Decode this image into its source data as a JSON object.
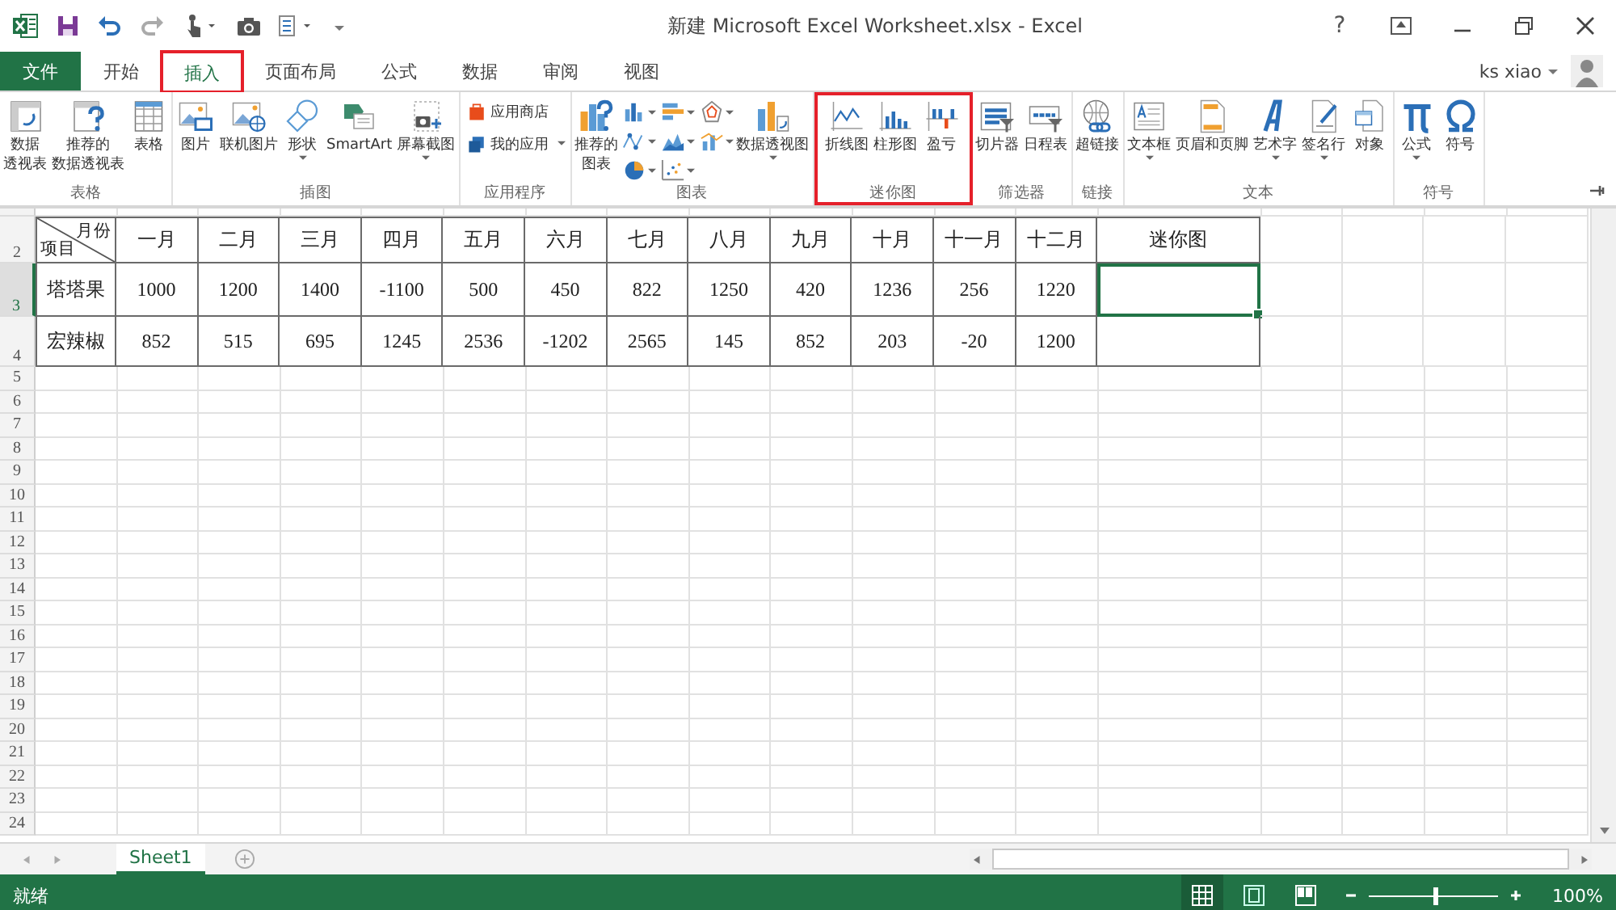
{
  "window": {
    "title": "新建 Microsoft Excel Worksheet.xlsx - Excel",
    "help": "?"
  },
  "tabs": [
    {
      "label": "文件",
      "kind": "file",
      "selected": false,
      "annotated": false
    },
    {
      "label": "开始",
      "kind": "tab",
      "selected": false,
      "annotated": false
    },
    {
      "label": "插入",
      "kind": "tab",
      "selected": true,
      "annotated": true
    },
    {
      "label": "页面布局",
      "kind": "tab",
      "selected": false,
      "annotated": false
    },
    {
      "label": "公式",
      "kind": "tab",
      "selected": false,
      "annotated": false
    },
    {
      "label": "数据",
      "kind": "tab",
      "selected": false,
      "annotated": false
    },
    {
      "label": "审阅",
      "kind": "tab",
      "selected": false,
      "annotated": false
    },
    {
      "label": "视图",
      "kind": "tab",
      "selected": false,
      "annotated": false
    }
  ],
  "user": {
    "name": "ks xiao"
  },
  "ribbon": [
    {
      "label": "表格",
      "annotated": false,
      "items": [
        {
          "kind": "large",
          "label": "数据透视表",
          "dropdown": false
        },
        {
          "kind": "large",
          "label": "推荐的数据透视表",
          "dropdown": false
        },
        {
          "kind": "large",
          "label": "表格",
          "dropdown": false
        }
      ]
    },
    {
      "label": "插图",
      "annotated": false,
      "items": [
        {
          "kind": "large",
          "label": "图片",
          "dropdown": false
        },
        {
          "kind": "large",
          "label": "联机图片",
          "dropdown": false
        },
        {
          "kind": "large",
          "label": "形状",
          "dropdown": true
        },
        {
          "kind": "large",
          "label": "SmartArt",
          "dropdown": false
        },
        {
          "kind": "large",
          "label": "屏幕截图",
          "dropdown": true
        }
      ]
    },
    {
      "label": "应用程序",
      "annotated": false,
      "items": [
        {
          "kind": "small",
          "label": "应用商店",
          "dropdown": false
        },
        {
          "kind": "small",
          "label": "我的应用",
          "dropdown": true
        }
      ]
    },
    {
      "label": "图表",
      "annotated": false,
      "items": [
        {
          "kind": "large",
          "label": "推荐的图表",
          "dropdown": false
        },
        {
          "kind": "gallery"
        },
        {
          "kind": "large",
          "label": "数据透视图",
          "dropdown": true
        }
      ]
    },
    {
      "label": "迷你图",
      "annotated": true,
      "items": [
        {
          "kind": "large",
          "label": "折线图",
          "dropdown": false
        },
        {
          "kind": "large",
          "label": "柱形图",
          "dropdown": false
        },
        {
          "kind": "large",
          "label": "盈亏",
          "dropdown": false
        }
      ]
    },
    {
      "label": "筛选器",
      "annotated": false,
      "items": [
        {
          "kind": "large",
          "label": "切片器",
          "dropdown": false
        },
        {
          "kind": "large",
          "label": "日程表",
          "dropdown": false
        }
      ]
    },
    {
      "label": "链接",
      "annotated": false,
      "items": [
        {
          "kind": "large",
          "label": "超链接",
          "dropdown": false
        }
      ]
    },
    {
      "label": "文本",
      "annotated": false,
      "items": [
        {
          "kind": "large",
          "label": "文本框",
          "dropdown": true
        },
        {
          "kind": "large",
          "label": "页眉和页脚",
          "dropdown": false
        },
        {
          "kind": "large",
          "label": "艺术字",
          "dropdown": true
        },
        {
          "kind": "large",
          "label": "签名行",
          "dropdown": true
        },
        {
          "kind": "large",
          "label": "对象",
          "dropdown": false
        }
      ]
    },
    {
      "label": "符号",
      "annotated": false,
      "items": [
        {
          "kind": "large",
          "label": "公式",
          "dropdown": true
        },
        {
          "kind": "large",
          "label": "符号",
          "dropdown": false
        }
      ]
    }
  ],
  "sheet": {
    "row_numbers": [
      {
        "label": "2",
        "selected": false
      },
      {
        "label": "3",
        "selected": true
      },
      {
        "label": "4",
        "selected": false
      },
      {
        "label": "5",
        "selected": false
      },
      {
        "label": "6",
        "selected": false
      },
      {
        "label": "7",
        "selected": false
      },
      {
        "label": "8",
        "selected": false
      },
      {
        "label": "9",
        "selected": false
      },
      {
        "label": "10",
        "selected": false
      },
      {
        "label": "11",
        "selected": false
      },
      {
        "label": "12",
        "selected": false
      },
      {
        "label": "13",
        "selected": false
      },
      {
        "label": "14",
        "selected": false
      },
      {
        "label": "15",
        "selected": false
      },
      {
        "label": "16",
        "selected": false
      },
      {
        "label": "17",
        "selected": false
      },
      {
        "label": "18",
        "selected": false
      },
      {
        "label": "19",
        "selected": false
      },
      {
        "label": "20",
        "selected": false
      },
      {
        "label": "21",
        "selected": false
      },
      {
        "label": "22",
        "selected": false
      },
      {
        "label": "23",
        "selected": false
      },
      {
        "label": "24",
        "selected": false
      }
    ],
    "corner": {
      "top": "月份",
      "bottom": "项目"
    },
    "months": [
      "一月",
      "二月",
      "三月",
      "四月",
      "五月",
      "六月",
      "七月",
      "八月",
      "九月",
      "十月",
      "十一月",
      "十二月"
    ],
    "last_header": "迷你图",
    "rows": [
      {
        "item": "塔塔果",
        "values": [
          "1000",
          "1200",
          "1400",
          "-1100",
          "500",
          "450",
          "822",
          "1250",
          "420",
          "1236",
          "256",
          "1220"
        ],
        "sparkline_selected": true
      },
      {
        "item": "宏辣椒",
        "values": [
          "852",
          "515",
          "695",
          "1245",
          "2536",
          "-1202",
          "2565",
          "145",
          "852",
          "203",
          "-20",
          "1200"
        ],
        "sparkline_selected": false
      }
    ]
  },
  "sheet_tabs": [
    {
      "label": "Sheet1",
      "selected": true
    }
  ],
  "status_bar": {
    "text": "就绪",
    "views": [
      {
        "selected": true
      },
      {
        "selected": false
      },
      {
        "selected": false
      }
    ],
    "zoom": {
      "level": 0.52,
      "reading": "100%"
    }
  }
}
